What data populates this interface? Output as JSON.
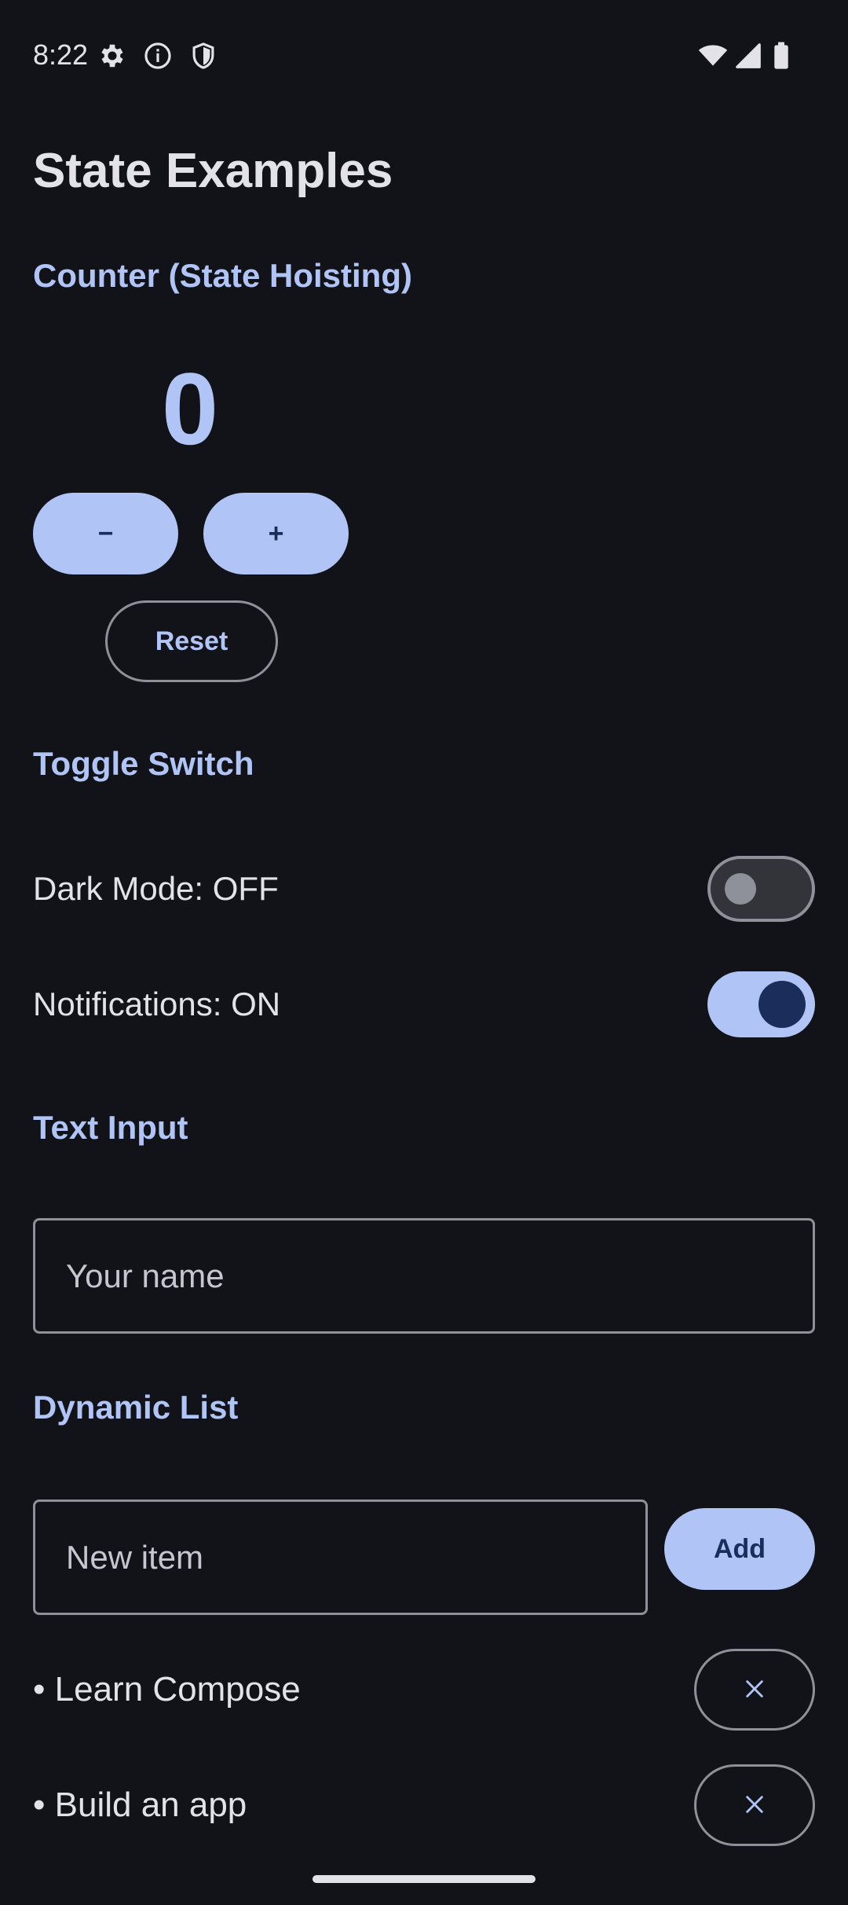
{
  "status_bar": {
    "time": "8:22",
    "left_icons": [
      "gear-icon",
      "info-icon",
      "shield-icon"
    ],
    "right_icons": [
      "wifi-icon",
      "signal-icon",
      "battery-icon"
    ]
  },
  "page": {
    "title": "State Examples"
  },
  "counter_section": {
    "title": "Counter (State Hoisting)",
    "value": "0",
    "decrement_label": "−",
    "increment_label": "+",
    "reset_label": "Reset"
  },
  "toggle_section": {
    "title": "Toggle Switch",
    "dark_mode_label": "Dark Mode: OFF",
    "dark_mode_on": false,
    "notifications_label": "Notifications: ON",
    "notifications_on": true
  },
  "text_input_section": {
    "title": "Text Input",
    "name_value": "",
    "name_placeholder": "Your name"
  },
  "dynamic_list_section": {
    "title": "Dynamic List",
    "new_item_value": "",
    "new_item_placeholder": "New item",
    "add_label": "Add",
    "items": [
      {
        "label": "• Learn Compose"
      },
      {
        "label": "• Build an app"
      }
    ]
  },
  "colors": {
    "background": "#121318",
    "primary": "#b0c4f5",
    "on_primary": "#1b2d5b",
    "on_surface": "#e3e2e9",
    "outline": "#8e909a"
  }
}
